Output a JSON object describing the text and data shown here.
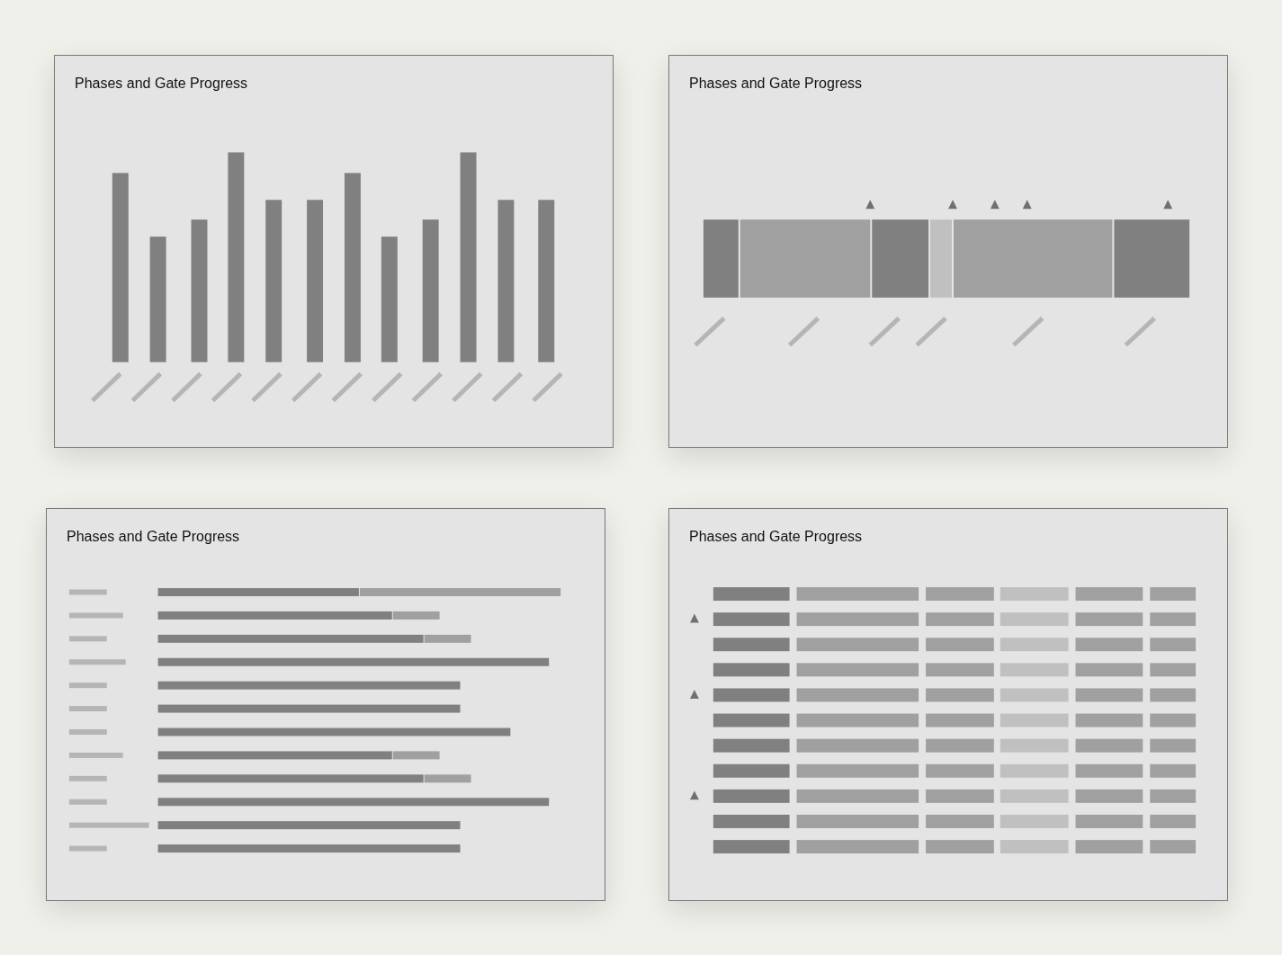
{
  "cards": [
    {
      "title": "Phases and Gate Progress",
      "kind": "columns"
    },
    {
      "title": "Phases and Gate Progress",
      "kind": "timeline"
    },
    {
      "title": "Phases and Gate Progress",
      "kind": "bars"
    },
    {
      "title": "Phases and Gate Progress",
      "kind": "grid"
    }
  ]
}
